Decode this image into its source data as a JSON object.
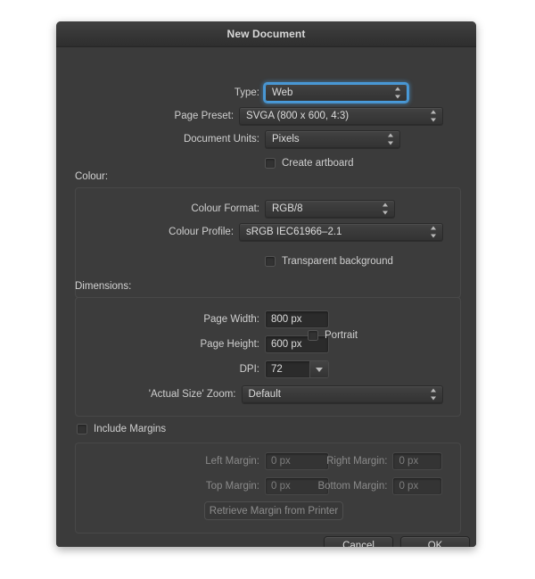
{
  "window": {
    "title": "New Document"
  },
  "form": {
    "type": {
      "label": "Type:",
      "value": "Web"
    },
    "page_preset": {
      "label": "Page Preset:",
      "value": "SVGA  (800 x 600, 4:3)"
    },
    "document_units": {
      "label": "Document Units:",
      "value": "Pixels"
    },
    "create_artboard": {
      "label": "Create artboard",
      "checked": false
    }
  },
  "colour": {
    "section_title": "Colour:",
    "colour_format": {
      "label": "Colour Format:",
      "value": "RGB/8"
    },
    "colour_profile": {
      "label": "Colour Profile:",
      "value": "sRGB IEC61966–2.1"
    },
    "transparent_background": {
      "label": "Transparent background",
      "checked": false
    }
  },
  "dimensions": {
    "section_title": "Dimensions:",
    "page_width": {
      "label": "Page Width:",
      "value": "800 px"
    },
    "page_height": {
      "label": "Page Height:",
      "value": "600 px"
    },
    "dpi": {
      "label": "DPI:",
      "value": "72"
    },
    "actual_size_zoom": {
      "label": "'Actual Size' Zoom:",
      "value": "Default"
    },
    "portrait": {
      "label": "Portrait",
      "checked": false
    }
  },
  "margins": {
    "include_margins": {
      "label": "Include Margins",
      "checked": false
    },
    "left_margin": {
      "label": "Left Margin:",
      "value": "0 px"
    },
    "right_margin": {
      "label": "Right Margin:",
      "value": "0 px"
    },
    "top_margin": {
      "label": "Top Margin:",
      "value": "0 px"
    },
    "bottom_margin": {
      "label": "Bottom Margin:",
      "value": "0 px"
    },
    "retrieve_button": "Retrieve Margin from Printer"
  },
  "footer": {
    "cancel": "Cancel",
    "ok": "OK"
  },
  "colors": {
    "dialog_bg": "#3b3b3b",
    "focus_ring": "#4a9fe0",
    "text": "#dcdcdc",
    "text_disabled": "#8a8a8a"
  }
}
